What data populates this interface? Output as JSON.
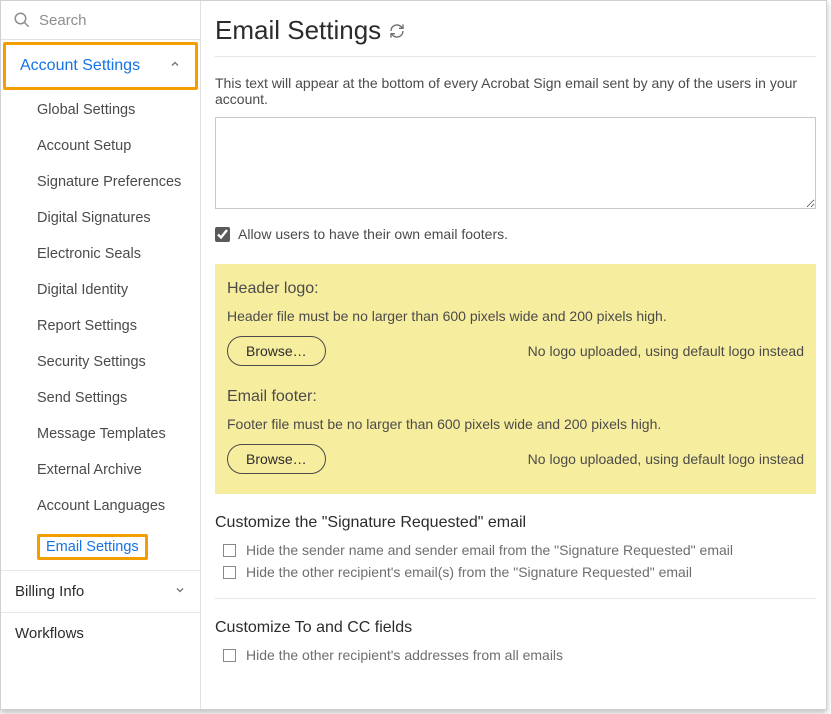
{
  "search": {
    "placeholder": "Search"
  },
  "sidebar": {
    "account_settings_label": "Account Settings",
    "items": [
      "Global Settings",
      "Account Setup",
      "Signature Preferences",
      "Digital Signatures",
      "Electronic Seals",
      "Digital Identity",
      "Report Settings",
      "Security Settings",
      "Send Settings",
      "Message Templates",
      "External Archive",
      "Account Languages",
      "Email Settings"
    ],
    "billing_label": "Billing Info",
    "workflows_label": "Workflows"
  },
  "page": {
    "title": "Email Settings",
    "intro": "This text will appear at the bottom of every Acrobat Sign email sent by any of the users in your account.",
    "allow_own_footers": "Allow users to have their own email footers.",
    "header_logo": {
      "heading": "Header logo:",
      "desc": "Header file must be no larger than 600 pixels wide and 200 pixels high.",
      "browse": "Browse…",
      "status": "No logo uploaded, using default logo instead"
    },
    "email_footer": {
      "heading": "Email footer:",
      "desc": "Footer file must be no larger than 600 pixels wide and 200 pixels high.",
      "browse": "Browse…",
      "status": "No logo uploaded, using default logo instead"
    },
    "sig_req": {
      "heading": "Customize the \"Signature Requested\" email",
      "opt1": "Hide the sender name and sender email from the \"Signature Requested\" email",
      "opt2": "Hide the other recipient's email(s) from the \"Signature Requested\" email"
    },
    "to_cc": {
      "heading": "Customize To and CC fields",
      "opt1": "Hide the other recipient's addresses from all emails"
    }
  }
}
